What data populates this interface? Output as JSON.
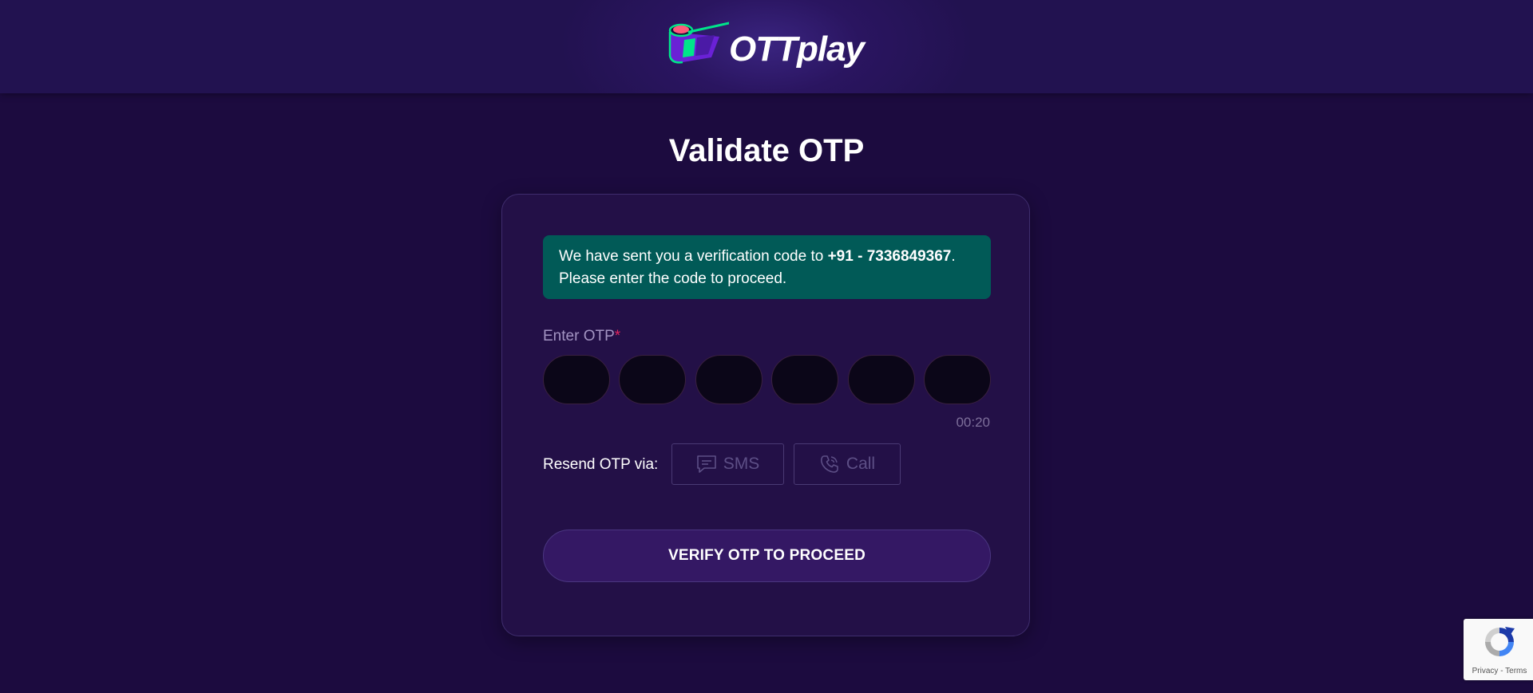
{
  "header": {
    "logo_text": "OTTplay"
  },
  "page_title": "Validate OTP",
  "notice": {
    "prefix": "We have sent you a verification code to ",
    "phone": "+91 - 7336849367",
    "suffix": ".",
    "line2": "Please enter the code to proceed."
  },
  "otp": {
    "label": "Enter OTP",
    "required_mark": "*",
    "digits": [
      "",
      "",
      "",
      "",
      "",
      ""
    ],
    "timer": "00:20"
  },
  "resend": {
    "label": "Resend OTP via:",
    "sms_label": "SMS",
    "sms_icon": "chat-bubble-icon",
    "call_label": "Call",
    "call_icon": "phone-icon"
  },
  "verify_button_label": "VERIFY OTP TO PROCEED",
  "recaptcha": {
    "privacy": "Privacy",
    "separator": " - ",
    "terms": "Terms"
  },
  "colors": {
    "background": "#1c0b3f",
    "card": "#231047",
    "notice": "#015a57",
    "required": "#e0245e",
    "logo_green": "#00e58a",
    "logo_purple": "#7b2ff7",
    "logo_pink": "#ff5a7a"
  }
}
